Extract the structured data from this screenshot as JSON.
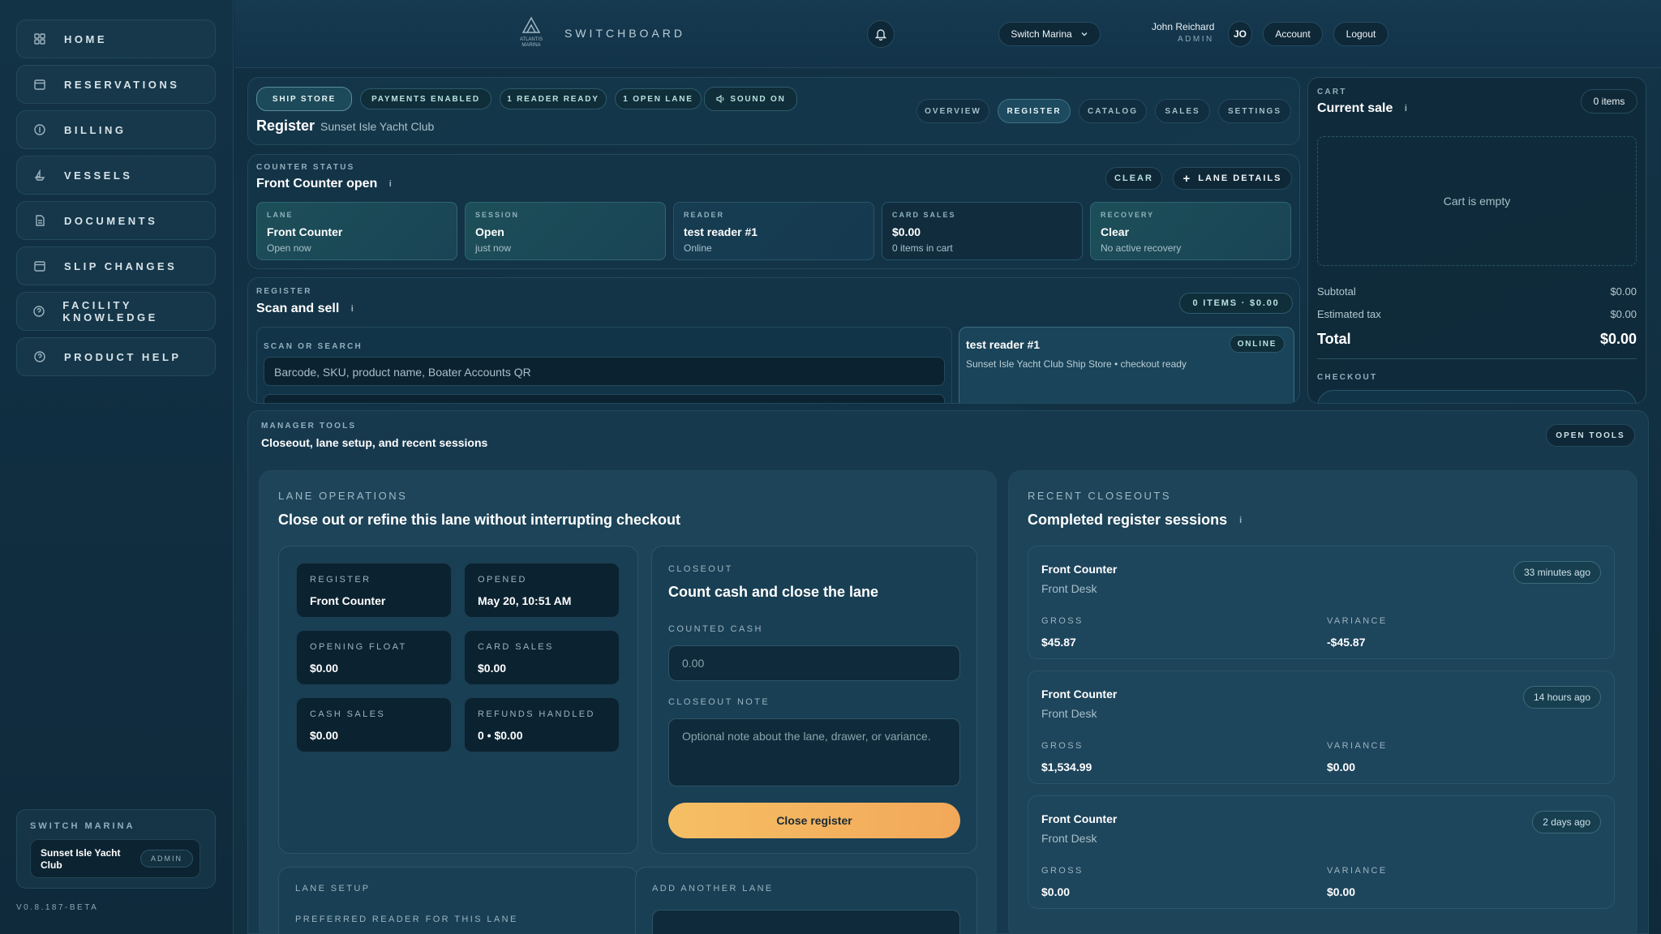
{
  "sidebar": {
    "items": [
      {
        "label": "HOME",
        "icon": "grid-icon"
      },
      {
        "label": "RESERVATIONS",
        "icon": "calendar-icon"
      },
      {
        "label": "BILLING",
        "icon": "dollar-icon"
      },
      {
        "label": "VESSELS",
        "icon": "boat-icon"
      },
      {
        "label": "DOCUMENTS",
        "icon": "document-icon"
      },
      {
        "label": "SLIP CHANGES",
        "icon": "calendar-icon"
      },
      {
        "label": "FACILITY KNOWLEDGE",
        "icon": "help-icon"
      },
      {
        "label": "PRODUCT HELP",
        "icon": "help-icon"
      }
    ],
    "marina_title": "SWITCH MARINA",
    "marina_name": "Sunset Isle Yacht Club",
    "marina_role": "ADMIN",
    "version": "V0.8.187-BETA"
  },
  "topbar": {
    "logo_line1": "ATLANTIS",
    "logo_line2": "MARINA",
    "brand": "SWITCHBOARD",
    "marina_switch": "Switch Marina",
    "user_name": "John Reichard",
    "user_role": "ADMIN",
    "initials": "JO",
    "account": "Account",
    "logout": "Logout"
  },
  "register": {
    "tags": [
      "SHIP STORE",
      "PAYMENTS ENABLED",
      "1 READER READY",
      "1 OPEN LANE",
      "SOUND ON"
    ],
    "title": "Register",
    "subtitle": "Sunset Isle Yacht Club",
    "tabs": [
      "OVERVIEW",
      "REGISTER",
      "CATALOG",
      "SALES",
      "SETTINGS"
    ],
    "counter_caption": "COUNTER STATUS",
    "counter_title": "Front Counter open",
    "clear": "CLEAR",
    "lane_details": "LANE DETAILS",
    "stats": [
      {
        "k": "LANE",
        "v": "Front Counter",
        "s": "Open now"
      },
      {
        "k": "SESSION",
        "v": "Open",
        "s": "just now"
      },
      {
        "k": "READER",
        "v": "test reader #1",
        "s": "Online"
      },
      {
        "k": "CARD SALES",
        "v": "$0.00",
        "s": "0 items in cart"
      },
      {
        "k": "RECOVERY",
        "v": "Clear",
        "s": "No active recovery"
      }
    ],
    "scan_caption": "REGISTER",
    "scan_title": "Scan and sell",
    "items_badge": "0 ITEMS · $0.00",
    "search_caption": "SCAN OR SEARCH",
    "search_placeholder": "Barcode, SKU, product name, Boater Accounts QR",
    "reader_name": "test reader #1",
    "reader_status": "ONLINE",
    "reader_sub": "Sunset Isle Yacht Club Ship Store • checkout ready"
  },
  "cart": {
    "caption": "CART",
    "title": "Current sale",
    "count": "0 items",
    "empty": "Cart is empty",
    "subtotal_label": "Subtotal",
    "subtotal": "$0.00",
    "tax_label": "Estimated tax",
    "tax": "$0.00",
    "total_label": "Total",
    "total": "$0.00",
    "checkout_caption": "CHECKOUT"
  },
  "manager": {
    "caption": "MANAGER TOOLS",
    "title": "Closeout, lane setup, and recent sessions",
    "open_tools": "OPEN TOOLS",
    "lane_caption": "LANE OPERATIONS",
    "lane_title": "Close out or refine this lane without interrupting checkout",
    "minis": [
      {
        "k": "REGISTER",
        "v": "Front Counter"
      },
      {
        "k": "OPENED",
        "v": "May 20, 10:51 AM"
      },
      {
        "k": "OPENING FLOAT",
        "v": "$0.00"
      },
      {
        "k": "CARD SALES",
        "v": "$0.00"
      },
      {
        "k": "CASH SALES",
        "v": "$0.00"
      },
      {
        "k": "REFUNDS HANDLED",
        "v": "0 • $0.00"
      }
    ],
    "closeout_caption": "CLOSEOUT",
    "closeout_title": "Count cash and close the lane",
    "counted_cash_label": "COUNTED CASH",
    "counted_cash_placeholder": "0.00",
    "note_label": "CLOSEOUT NOTE",
    "note_placeholder": "Optional note about the lane, drawer, or variance.",
    "close_button": "Close register",
    "lane_setup": "LANE SETUP",
    "preferred_reader": "PREFERRED READER FOR THIS LANE",
    "add_lane": "ADD ANOTHER LANE",
    "recent_caption": "RECENT CLOSEOUTS",
    "recent_title": "Completed register sessions",
    "closeouts": [
      {
        "title": "Front Counter",
        "sub": "Front Desk",
        "time": "33 minutes ago",
        "gross_label": "GROSS",
        "gross": "$45.87",
        "variance_label": "VARIANCE",
        "variance": "-$45.87"
      },
      {
        "title": "Front Counter",
        "sub": "Front Desk",
        "time": "14 hours ago",
        "gross_label": "GROSS",
        "gross": "$1,534.99",
        "variance_label": "VARIANCE",
        "variance": "$0.00"
      },
      {
        "title": "Front Counter",
        "sub": "Front Desk",
        "time": "2 days ago",
        "gross_label": "GROSS",
        "gross": "$0.00",
        "variance_label": "VARIANCE",
        "variance": "$0.00"
      }
    ]
  },
  "colors": {
    "accent": "#f4b25c",
    "teal": "#1c4f59",
    "bg": "#133447"
  }
}
